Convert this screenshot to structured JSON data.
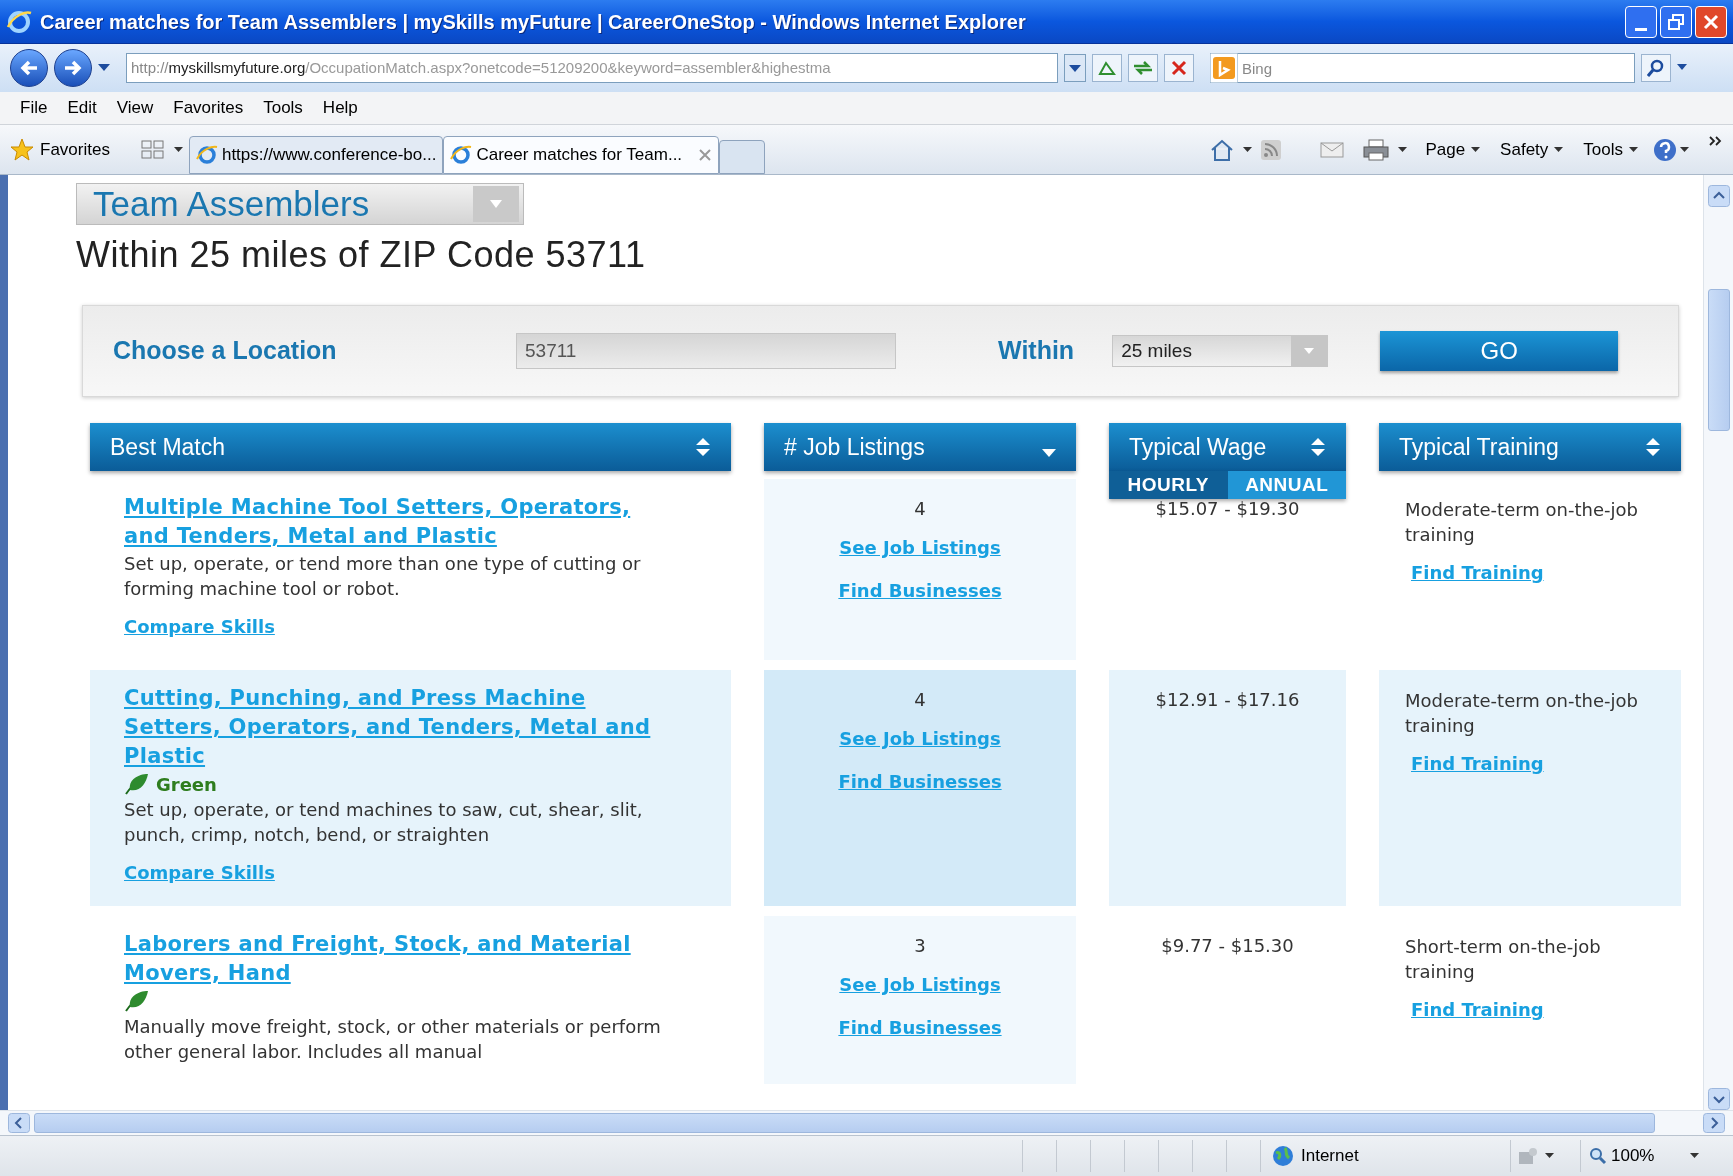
{
  "window": {
    "title": "Career matches for Team Assemblers | mySkills myFuture | CareerOneStop - Windows Internet Explorer"
  },
  "address_bar": {
    "url": {
      "scheme": "http://",
      "host": "myskillsmyfuture.org",
      "path": "/OccupationMatch.aspx?onetcode=51209200&keyword=assembler&highestma"
    },
    "search_placeholder": "Bing"
  },
  "menu": [
    "File",
    "Edit",
    "View",
    "Favorites",
    "Tools",
    "Help"
  ],
  "favorites_bar": {
    "label": "Favorites",
    "tabs": [
      {
        "label": "https://www.conference-bo...",
        "selected": false
      },
      {
        "label": "Career matches for Team...",
        "selected": true
      }
    ],
    "commands": [
      "Page",
      "Safety",
      "Tools"
    ]
  },
  "page": {
    "occupation": "Team Assemblers",
    "subtitle": "Within 25 miles of ZIP Code 53711",
    "location": {
      "label": "Choose a Location",
      "zip": "53711",
      "within_label": "Within",
      "radius": "25 miles",
      "go": "GO"
    },
    "columns": [
      {
        "label": "Best Match",
        "kind": "sortable"
      },
      {
        "label": "# Job Listings",
        "kind": "sorted"
      },
      {
        "label": "Typical Wage",
        "kind": "sortable"
      },
      {
        "label": "Typical Training",
        "kind": "sortable"
      }
    ],
    "wage_toggle": [
      {
        "label": "HOURLY",
        "selected": true
      },
      {
        "label": "ANNUAL",
        "selected": false
      }
    ],
    "rows": [
      {
        "title": "Multiple Machine Tool Setters, Operators, and Tenders, Metal and Plastic",
        "green": false,
        "description": "Set up, operate, or tend more than one type of cutting or forming machine tool or robot.",
        "compare": "Compare Skills",
        "listings": "4",
        "see": "See Job Listings",
        "find": "Find Businesses",
        "wage": "$15.07 - $19.30",
        "training": "Moderate-term on-the-job training",
        "find_training": "Find Training",
        "highlighted": false
      },
      {
        "title": "Cutting, Punching, and Press Machine Setters, Operators, and Tenders, Metal and Plastic",
        "green": true,
        "green_label": "Green",
        "description": "Set up, operate, or tend machines to saw, cut, shear, slit, punch, crimp, notch, bend, or straighten",
        "compare": "Compare Skills",
        "listings": "4",
        "see": "See Job Listings",
        "find": "Find Businesses",
        "wage": "$12.91 - $17.16",
        "training": "Moderate-term on-the-job training",
        "find_training": "Find Training",
        "highlighted": true
      },
      {
        "title": "Laborers and Freight, Stock, and Material Movers, Hand",
        "green": true,
        "description": "Manually move freight, stock, or other materials or perform other general labor. Includes all manual",
        "listings": "3",
        "see": "See Job Listings",
        "find": "Find Businesses",
        "wage": "$9.77 - $15.30",
        "training": "Short-term on-the-job training",
        "find_training": "Find Training",
        "highlighted": false
      }
    ]
  },
  "status_bar": {
    "zone": "Internet",
    "zoom": "100%"
  }
}
